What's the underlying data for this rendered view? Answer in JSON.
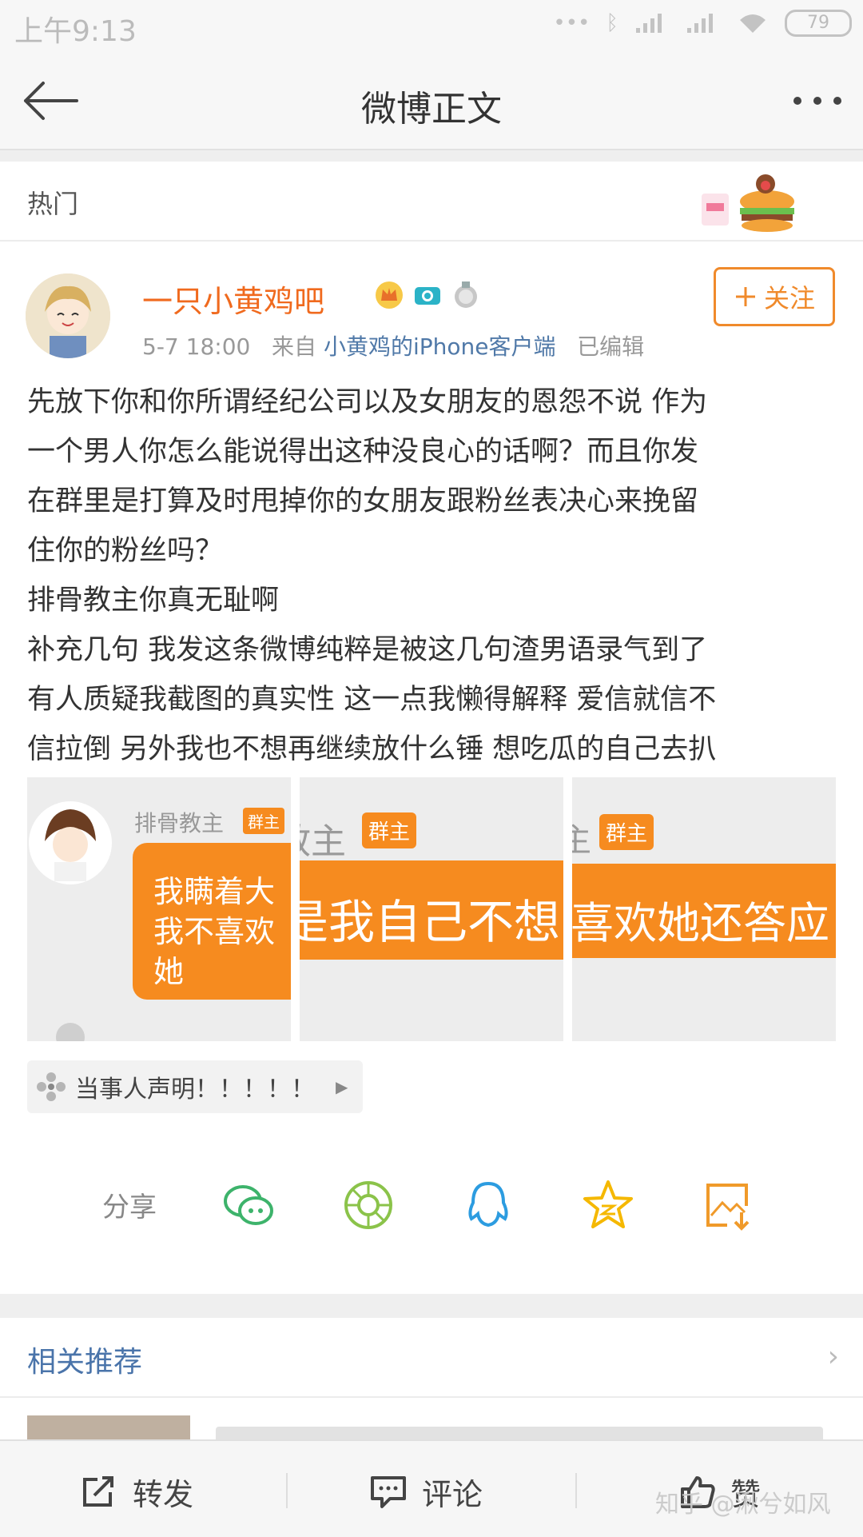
{
  "status_bar": {
    "time": "上午9:13",
    "battery": "79"
  },
  "nav": {
    "title": "微博正文"
  },
  "section": {
    "label": "热门"
  },
  "post": {
    "username": "一只小黄鸡吧",
    "date": "5-7 18:00",
    "from_prefix": "来自",
    "source": "小黄鸡的iPhone客户端",
    "edited": "已编辑",
    "follow_label": "关注",
    "lines": [
      "先放下你和你所谓经纪公司以及女朋友的恩怨不说 作为",
      "一个男人你怎么能说得出这种没良心的话啊？而且你发",
      "在群里是打算及时甩掉你的女朋友跟粉丝表决心来挽留",
      "住你的粉丝吗？",
      "排骨教主你真无耻啊",
      "补充几句 我发这条微博纯粹是被这几句渣男语录气到了",
      "有人质疑我截图的真实性 这一点我懒得解释 爱信就信不",
      "信拉倒 另外我也不想再继续放什么锤 想吃瓜的自己去扒"
    ],
    "shots": [
      {
        "name": "排骨教主",
        "tag": "群主",
        "bubble": [
          "我瞒着大",
          "我不喜欢",
          "她"
        ]
      },
      {
        "name_fragment": "教主",
        "tag": "群主",
        "bubble": "是我自己不想"
      },
      {
        "name_fragment": "主",
        "tag": "群主",
        "bubble": "喜欢她还答应"
      }
    ],
    "card_text": "当事人声明！！！！！"
  },
  "share": {
    "label": "分享",
    "icons": [
      "wechat-icon",
      "moments-icon",
      "qq-icon",
      "qzone-icon",
      "save-image-icon"
    ],
    "colors": {
      "wechat": "#3db36b",
      "moments": "#8bc34a",
      "qq": "#2c9ce0",
      "qzone": "#f5b800",
      "save": "#f09a2a"
    }
  },
  "related": {
    "label": "相关推荐"
  },
  "tabbar": {
    "repost": "转发",
    "comment": "评论",
    "like": "赞"
  },
  "watermark": "知乎 @湫兮如风",
  "colors": {
    "accent_orange": "#f06a1e",
    "link_blue": "#4a74aa",
    "chat_orange": "#f68b1f"
  }
}
